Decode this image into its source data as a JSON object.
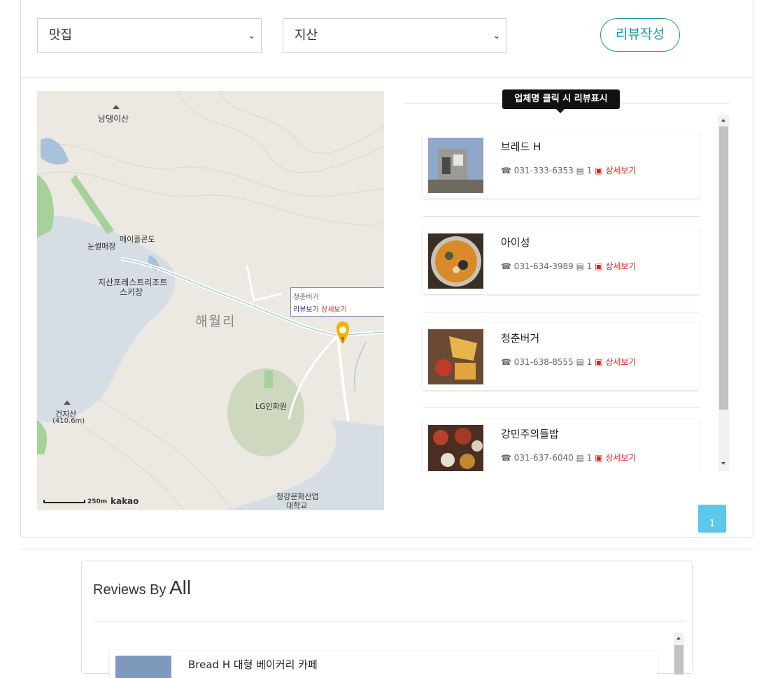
{
  "filters": {
    "category": "맛집",
    "region": "지산",
    "write_review_label": "리뷰작성"
  },
  "map": {
    "labels": {
      "mountain1": "낭댕이산",
      "resort_area": "눈썰매장",
      "condo": "메이플콘도",
      "ski1": "지산포레스트리조트",
      "ski2": "스키장",
      "village": "해월리",
      "lg": "LG인화원",
      "mountain2": "건지산",
      "mountain2_height": "(410.6m)",
      "college1": "청강문화산업",
      "college2": "대학교"
    },
    "infobox": {
      "name": "청춘버거",
      "review_link": "리뷰보기",
      "detail_link": "상세보기"
    },
    "scale": "250m",
    "provider": "kakao"
  },
  "list": {
    "tooltip": "업체명 클릭 시 리뷰표시",
    "items": [
      {
        "name": "브레드 H",
        "phone": "031-333-6353",
        "review_count": "1",
        "detail": "상세보기"
      },
      {
        "name": "아이성",
        "phone": "031-634-3989",
        "review_count": "1",
        "detail": "상세보기"
      },
      {
        "name": "청춘버거",
        "phone": "031-638-8555",
        "review_count": "1",
        "detail": "상세보기"
      },
      {
        "name": "강민주의들밥",
        "phone": "031-637-6040",
        "review_count": "1",
        "detail": "상세보기"
      }
    ],
    "page": "1"
  },
  "reviews": {
    "title_prefix": "Reviews By",
    "title_main": "All",
    "first_item": "Bread H 대형 베이커리 카페"
  },
  "colors": {
    "accent": "#1f97a8",
    "detail_red": "#d9251c",
    "pagination": "#5bc8ec"
  }
}
